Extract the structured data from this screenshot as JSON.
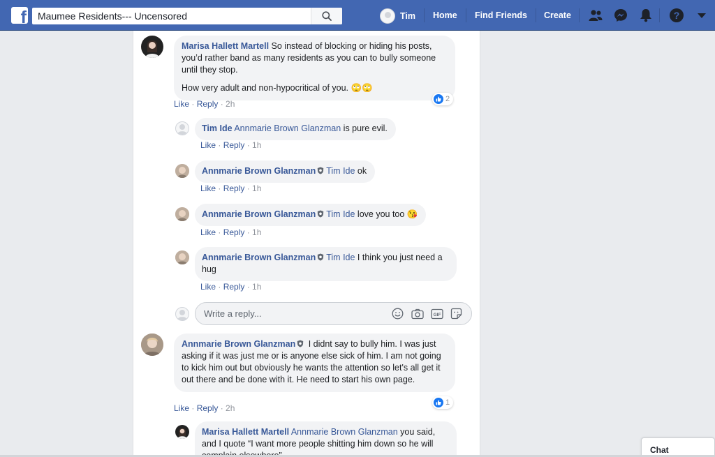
{
  "topbar": {
    "logo_letter": "f",
    "search_value": "Maumee Residents--- Uncensored",
    "user_name": "Tim",
    "nav": [
      "Home",
      "Find Friends",
      "Create"
    ],
    "icons": [
      "friend-requests-icon",
      "messenger-icon",
      "notifications-icon",
      "help-icon",
      "account-menu-icon"
    ]
  },
  "comments": [
    {
      "author": "Marisa Hallett Martell",
      "text": "So instead of blocking or hiding his posts, you’d rather band as many residents as you can to bully someone until they stop.",
      "text2": "How very adult and non-hypocritical of you. 🙄🙄",
      "like": "Like",
      "reply": "Reply",
      "time": "2h",
      "reaction_count": "2"
    },
    {
      "author": "Tim Ide",
      "mention": "Annmarie Brown Glanzman",
      "text": " is pure evil.",
      "like": "Like",
      "reply": "Reply",
      "time": "1h"
    },
    {
      "author": "Annmarie Brown Glanzman",
      "mention": "Tim Ide",
      "text": " ok",
      "like": "Like",
      "reply": "Reply",
      "time": "1h"
    },
    {
      "author": "Annmarie Brown Glanzman",
      "mention": "Tim Ide",
      "text": " love you too 😘",
      "like": "Like",
      "reply": "Reply",
      "time": "1h"
    },
    {
      "author": "Annmarie Brown Glanzman",
      "mention": "Tim Ide",
      "text": " I think you just need a hug",
      "like": "Like",
      "reply": "Reply",
      "time": "1h"
    },
    {
      "author": "Annmarie Brown Glanzman",
      "text": " I didnt say to bully him. I was just asking if it was just me or is anyone else sick of him. I am not going to kick him out but obviously he wants the attention so let's all get it out there and be done with it. He need to start his own page.",
      "like": "Like",
      "reply": "Reply",
      "time": "2h",
      "reaction_count": "1"
    },
    {
      "author": "Marisa Hallett Martell",
      "mention": "Annmarie Brown Glanzman",
      "text": " you said, and I quote “I want more people shitting him down so he will complain elsewhere”"
    }
  ],
  "reply_box": {
    "placeholder": "Write a reply...",
    "tools": [
      "emoji-icon",
      "camera-icon",
      "gif-icon",
      "sticker-icon"
    ]
  },
  "chat": {
    "label": "Chat"
  },
  "colors": {
    "brand": "#4267b2",
    "link": "#385898",
    "bubble": "#f2f3f5"
  }
}
